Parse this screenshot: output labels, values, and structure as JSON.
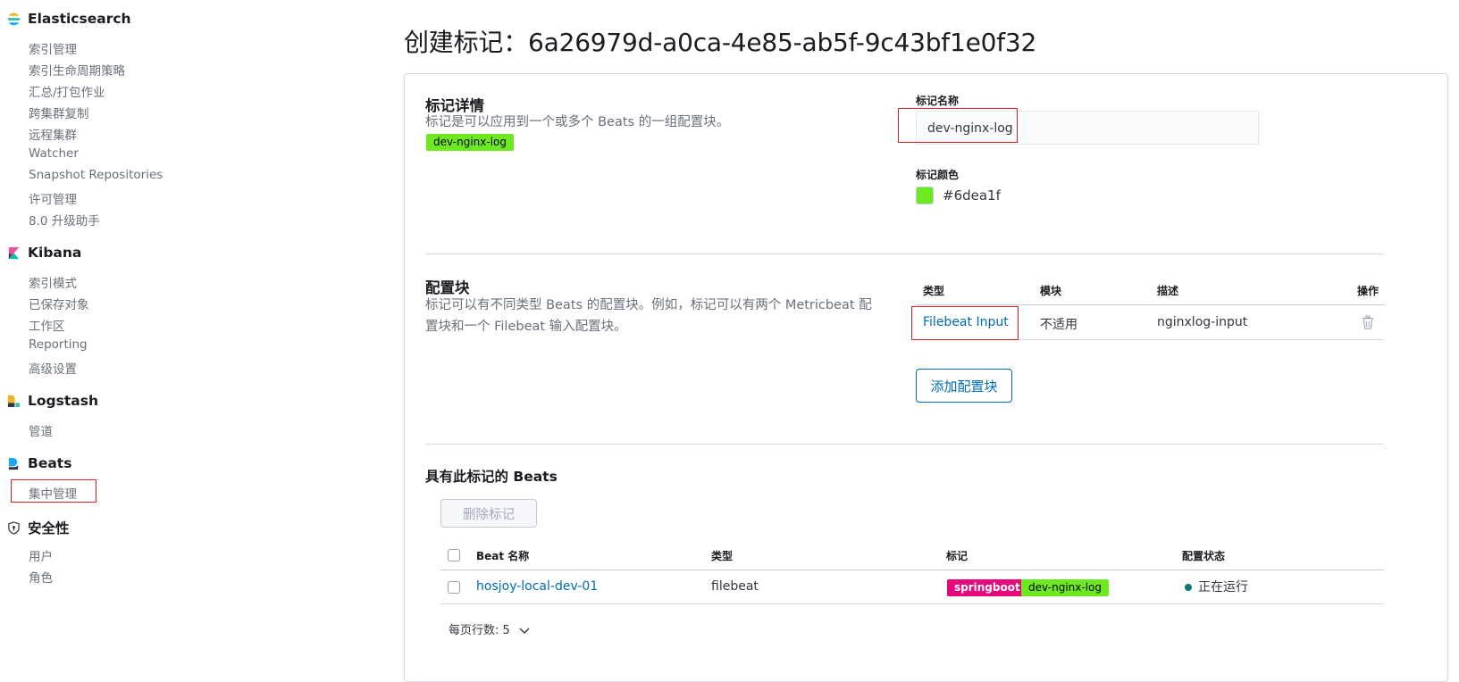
{
  "sidebar": {
    "elasticsearch": {
      "title": "Elasticsearch",
      "items": [
        "索引管理",
        "索引生命周期策略",
        "汇总/打包作业",
        "跨集群复制",
        "远程集群",
        "Watcher",
        "Snapshot Repositories",
        "许可管理",
        "8.0 升级助手"
      ]
    },
    "kibana": {
      "title": "Kibana",
      "items": [
        "索引模式",
        "已保存对象",
        "工作区",
        "Reporting",
        "高级设置"
      ]
    },
    "logstash": {
      "title": "Logstash",
      "items": [
        "管道"
      ]
    },
    "beats": {
      "title": "Beats",
      "items": [
        "集中管理"
      ]
    },
    "security": {
      "title": "安全性",
      "items": [
        "用户",
        "角色"
      ]
    }
  },
  "page": {
    "title": "创建标记：6a26979d-a0ca-4e85-ab5f-9c43bf1e0f32"
  },
  "tag_details": {
    "heading": "标记详情",
    "description": "标记是可以应用到一个或多个 Beats 的一组配置块。",
    "tag_badge": "dev-nginx-log",
    "name_label": "标记名称",
    "name_value": "dev-nginx-log",
    "color_label": "标记颜色",
    "color_value": "#6dea1f"
  },
  "config_blocks": {
    "heading": "配置块",
    "description_line1": "标记可以有不同类型 Beats 的配置块。例如，标记可以有两个 Metricbeat 配",
    "description_line2": "置块和一个 Filebeat 输入配置块。",
    "columns": [
      "类型",
      "模块",
      "描述",
      "操作"
    ],
    "rows": [
      {
        "type": "Filebeat Input",
        "module": "不适用",
        "description": "nginxlog-input",
        "action_icon": "trash-icon"
      }
    ],
    "add_button": "添加配置块"
  },
  "beats_with_tag": {
    "heading": "具有此标记的 Beats",
    "remove_button": "删除标记",
    "columns": [
      "Beat 名称",
      "类型",
      "标记",
      "配置状态"
    ],
    "rows": [
      {
        "name": "hosjoy-local-dev-01",
        "type": "filebeat",
        "tags": [
          "springboot",
          "dev-nginx-log"
        ],
        "status": "正在运行"
      }
    ],
    "rows_per_page": "每页行数: 5"
  },
  "colors": {
    "tag_green": "#6dea1f",
    "tag_pink": "#e7087b",
    "link_blue": "#006bb4",
    "status_green": "#017d73",
    "highlight_red": "#e02020"
  }
}
